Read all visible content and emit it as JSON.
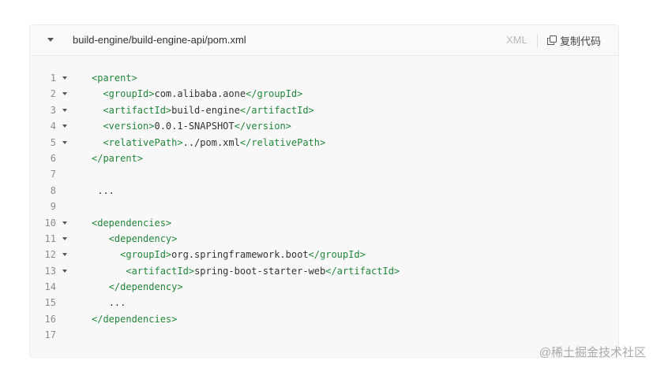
{
  "header": {
    "file_path": "build-engine/build-engine-api/pom.xml",
    "language": "XML",
    "copy_label": "复制代码"
  },
  "code": [
    {
      "num": "1",
      "fold": true,
      "indent": "",
      "parts": [
        [
          "t",
          "<parent>"
        ]
      ]
    },
    {
      "num": "2",
      "fold": true,
      "indent": "  ",
      "parts": [
        [
          "t",
          "<groupId>"
        ],
        [
          "x",
          "com.alibaba.aone"
        ],
        [
          "t",
          "</groupId>"
        ]
      ]
    },
    {
      "num": "3",
      "fold": true,
      "indent": "  ",
      "parts": [
        [
          "t",
          "<artifactId>"
        ],
        [
          "x",
          "build-engine"
        ],
        [
          "t",
          "</artifactId>"
        ]
      ]
    },
    {
      "num": "4",
      "fold": true,
      "indent": "  ",
      "parts": [
        [
          "t",
          "<version>"
        ],
        [
          "x",
          "0.0.1-SNAPSHOT"
        ],
        [
          "t",
          "</version>"
        ]
      ]
    },
    {
      "num": "5",
      "fold": true,
      "indent": "  ",
      "parts": [
        [
          "t",
          "<relativePath>"
        ],
        [
          "x",
          "../pom.xml"
        ],
        [
          "t",
          "</relativePath>"
        ]
      ]
    },
    {
      "num": "6",
      "fold": false,
      "indent": "",
      "parts": [
        [
          "t",
          "</parent>"
        ]
      ]
    },
    {
      "num": "7",
      "fold": false,
      "indent": "",
      "parts": []
    },
    {
      "num": "8",
      "fold": false,
      "indent": " ",
      "parts": [
        [
          "x",
          "..."
        ]
      ]
    },
    {
      "num": "9",
      "fold": false,
      "indent": "",
      "parts": []
    },
    {
      "num": "10",
      "fold": true,
      "indent": "",
      "parts": [
        [
          "t",
          "<dependencies>"
        ]
      ]
    },
    {
      "num": "11",
      "fold": true,
      "indent": "   ",
      "parts": [
        [
          "t",
          "<dependency>"
        ]
      ]
    },
    {
      "num": "12",
      "fold": true,
      "indent": "     ",
      "parts": [
        [
          "t",
          "<groupId>"
        ],
        [
          "x",
          "org.springframework.boot"
        ],
        [
          "t",
          "</groupId>"
        ]
      ]
    },
    {
      "num": "13",
      "fold": true,
      "indent": "      ",
      "parts": [
        [
          "t",
          "<artifactId>"
        ],
        [
          "x",
          "spring-boot-starter-web"
        ],
        [
          "t",
          "</artifactId>"
        ]
      ]
    },
    {
      "num": "14",
      "fold": false,
      "indent": "   ",
      "parts": [
        [
          "t",
          "</dependency>"
        ]
      ]
    },
    {
      "num": "15",
      "fold": false,
      "indent": "   ",
      "parts": [
        [
          "x",
          "..."
        ]
      ]
    },
    {
      "num": "16",
      "fold": false,
      "indent": "",
      "parts": [
        [
          "t",
          "</dependencies>"
        ]
      ]
    },
    {
      "num": "17",
      "fold": false,
      "indent": "",
      "parts": []
    }
  ],
  "watermark": "@稀土掘金技术社区",
  "colors": {
    "tag": "#22863a",
    "text": "#333333"
  }
}
